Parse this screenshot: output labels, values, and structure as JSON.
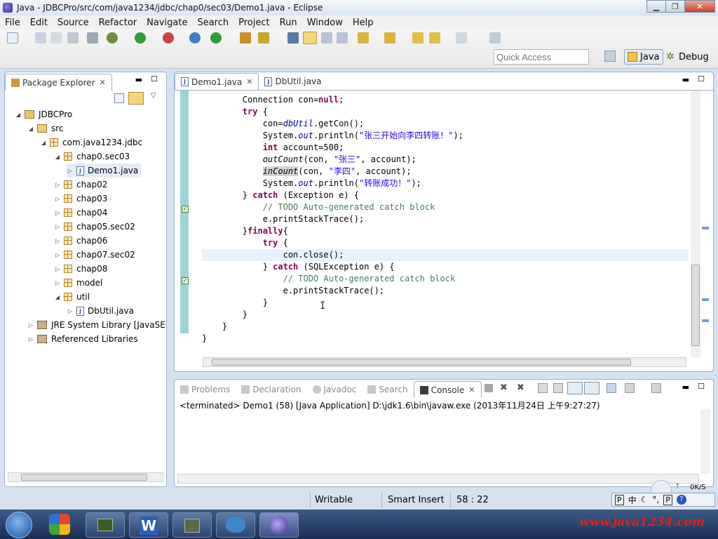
{
  "window": {
    "title": "Java - JDBCPro/src/com/java1234/jdbc/chap0/sec03/Demo1.java - Eclipse"
  },
  "menu": [
    "File",
    "Edit",
    "Source",
    "Refactor",
    "Navigate",
    "Search",
    "Project",
    "Run",
    "Window",
    "Help"
  ],
  "quick_access": {
    "placeholder": "Quick Access"
  },
  "perspectives": {
    "java": "Java",
    "debug": "Debug"
  },
  "explorer": {
    "tab": "Package Explorer",
    "tree": [
      {
        "label": "JDBCPro"
      },
      {
        "label": "src"
      },
      {
        "label": "com.java1234.jdbc"
      },
      {
        "label": "chap0.sec03"
      },
      {
        "label": "Demo1.java"
      },
      {
        "label": "chap02"
      },
      {
        "label": "chap03"
      },
      {
        "label": "chap04"
      },
      {
        "label": "chap05.sec02"
      },
      {
        "label": "chap06"
      },
      {
        "label": "chap07.sec02"
      },
      {
        "label": "chap08"
      },
      {
        "label": "model"
      },
      {
        "label": "util"
      },
      {
        "label": "DbUtil.java"
      },
      {
        "label": "JRE System Library [JavaSE"
      },
      {
        "label": "Referenced Libraries"
      }
    ]
  },
  "editor": {
    "tabs": [
      {
        "label": "Demo1.java"
      },
      {
        "label": "DbUtil.java"
      }
    ]
  },
  "console_view": {
    "tabs": [
      "Problems",
      "Declaration",
      "Javadoc",
      "Search",
      "Console"
    ],
    "output": "<terminated> Demo1 (58) [Java Application] D:\\jdk1.6\\bin\\javaw.exe (2013年11月24日 上午9:27:27)"
  },
  "status": {
    "writable": "Writable",
    "insert_mode": "Smart Insert",
    "position": "58 : 22"
  },
  "tray": {
    "speed": "0K/S",
    "ime": "中"
  },
  "watermark": "www.java1234.com",
  "colors": {
    "keyword": "#7f0055",
    "string": "#2a00ff",
    "comment": "#3f7f5f",
    "field": "#0000c0"
  }
}
